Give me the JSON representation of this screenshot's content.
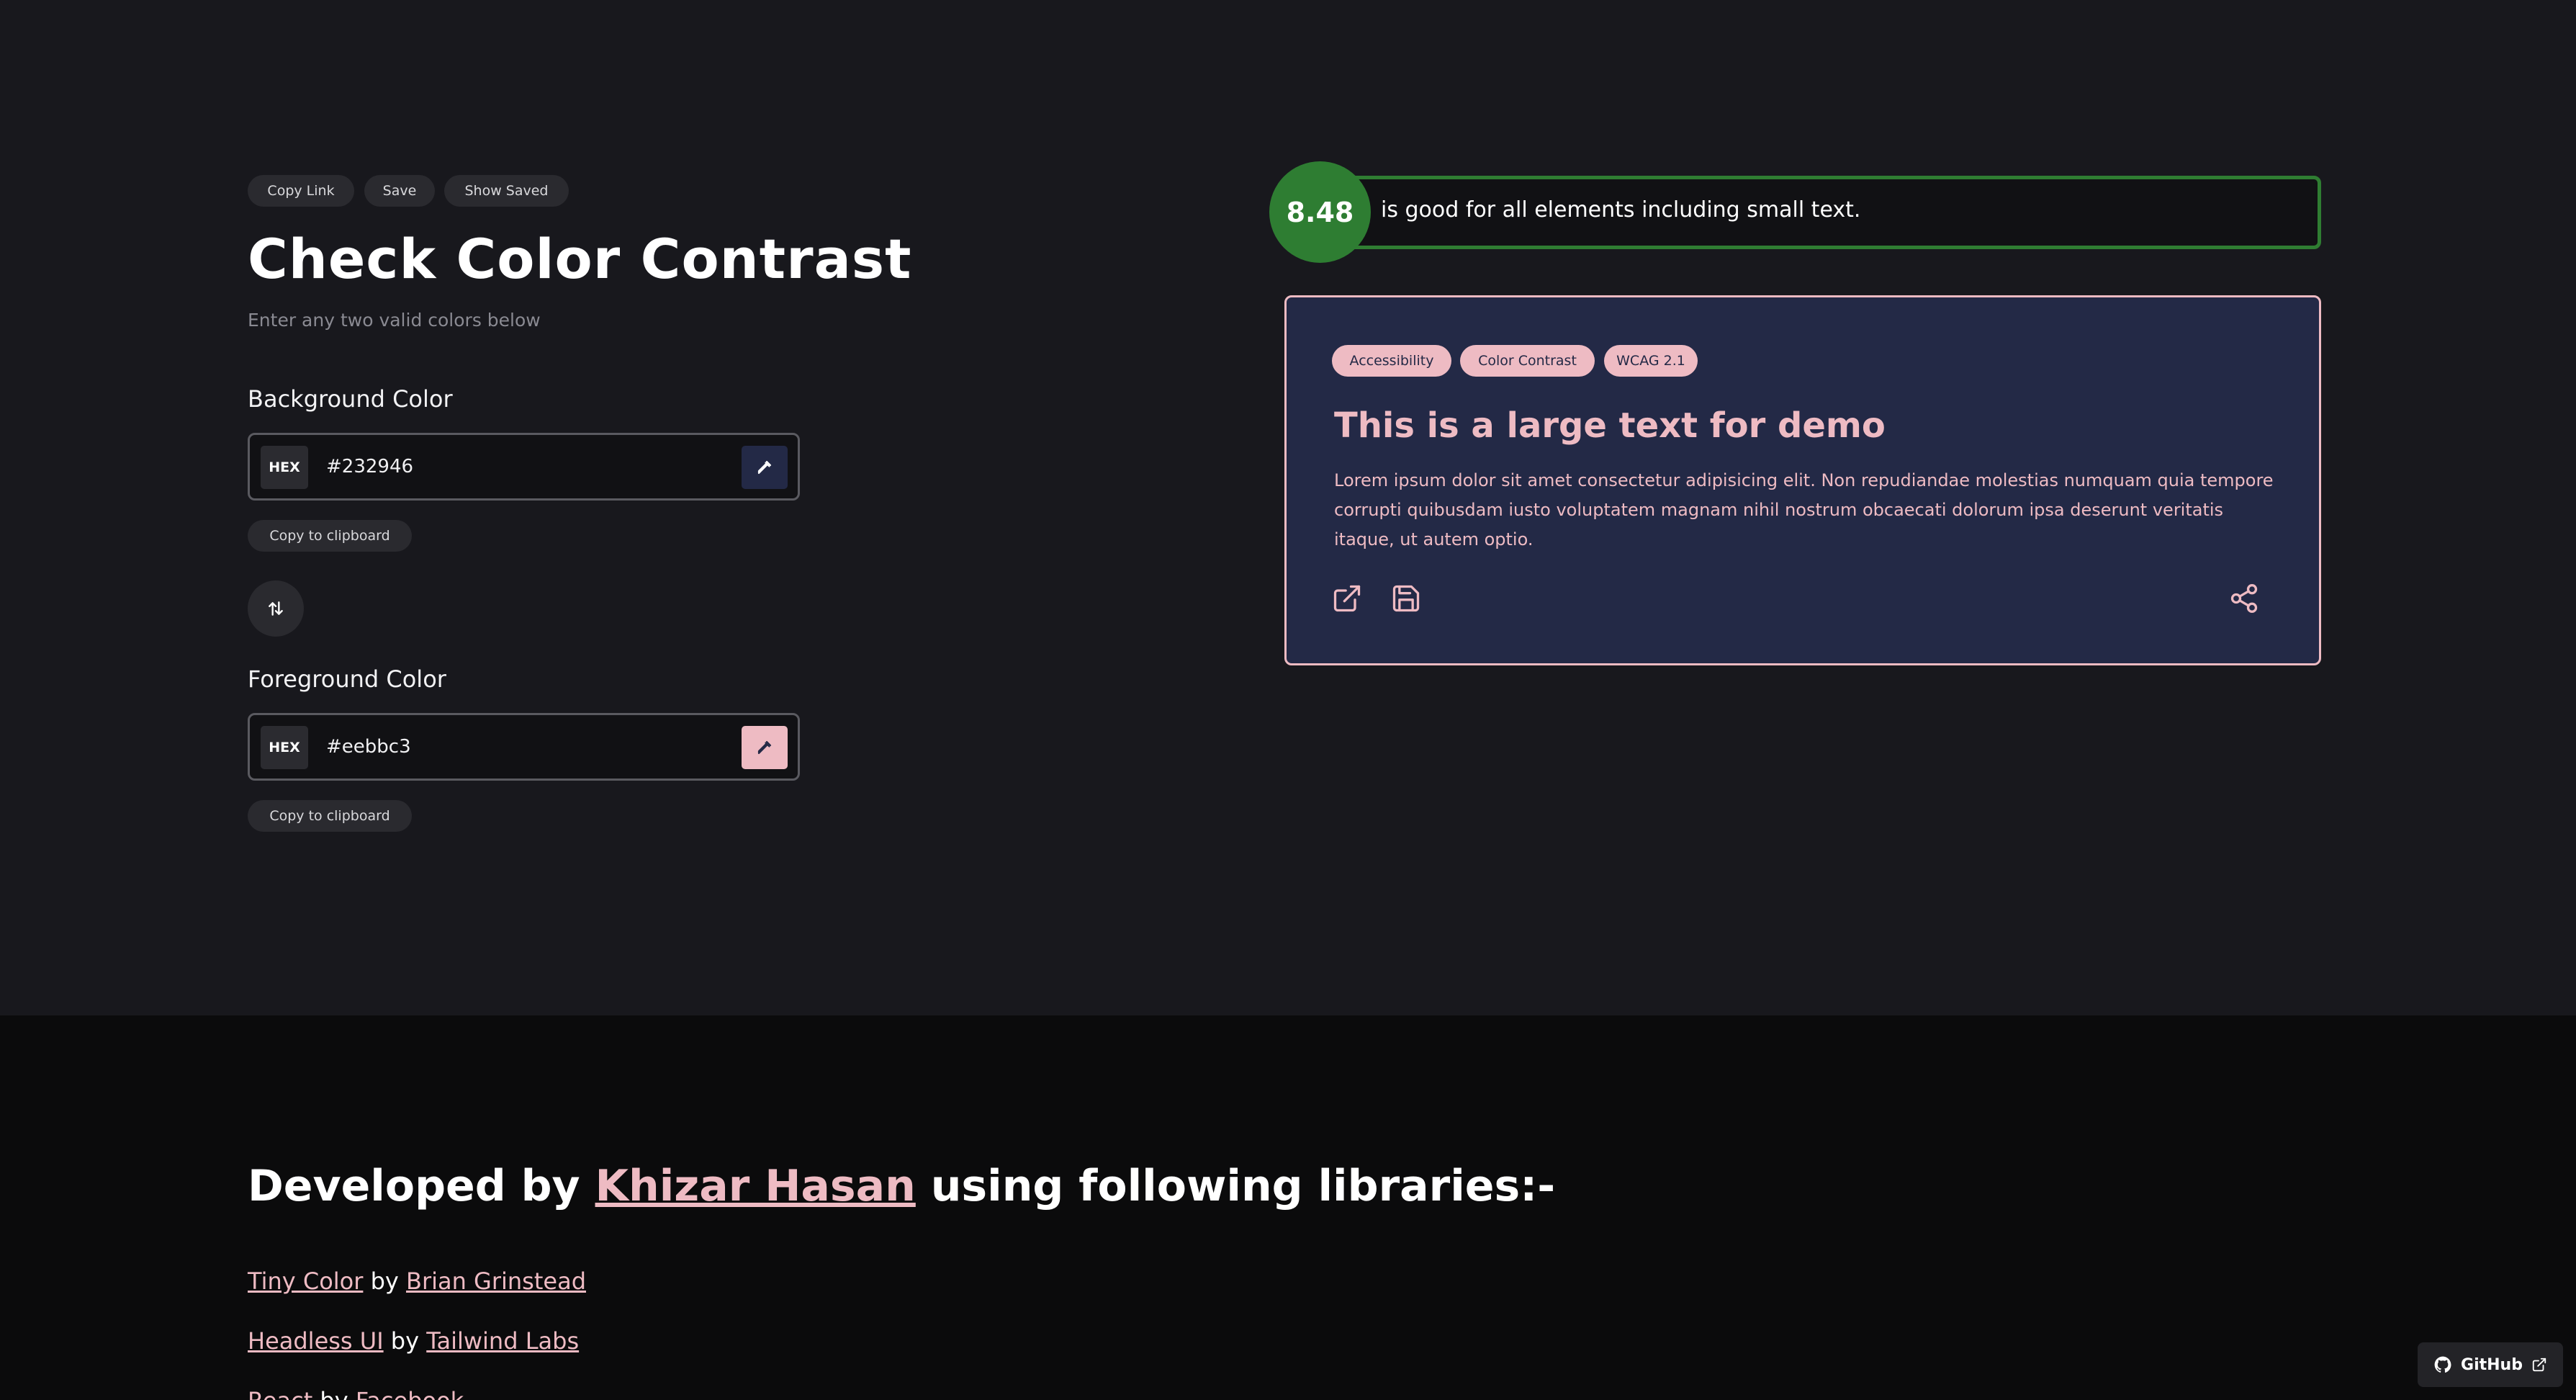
{
  "toolbar": {
    "copy_link": "Copy Link",
    "save": "Save",
    "show_saved": "Show Saved"
  },
  "header": {
    "title": "Check Color Contrast",
    "subtitle": "Enter any two valid colors below"
  },
  "background": {
    "label": "Background Color",
    "format": "HEX",
    "value": "#232946",
    "swatch_color": "#232946",
    "copy_label": "Copy to clipboard"
  },
  "foreground": {
    "label": "Foreground Color",
    "format": "HEX",
    "value": "#eebbc3",
    "swatch_color": "#eebbc3",
    "copy_label": "Copy to clipboard"
  },
  "score": {
    "ratio": "8.48",
    "message": "is good for all elements including small text.",
    "accent": "#2e7d32"
  },
  "preview": {
    "tags": [
      "Accessibility",
      "Color Contrast",
      "WCAG 2.1"
    ],
    "large_text": "This is a large text for demo",
    "paragraph": "Lorem ipsum dolor sit amet consectetur adipisicing elit. Non repudiandae molestias numquam quia tempore corrupti quibusdam iusto voluptatem magnam nihil nostrum obcaecati dolorum ipsa deserunt veritatis itaque, ut autem optio.",
    "icons": [
      "external-link-icon",
      "save-icon",
      "share-icon"
    ]
  },
  "footer": {
    "dev_prefix": "Developed by",
    "dev_name": "Khizar Hasan",
    "dev_suffix": "using following libraries:-",
    "libraries": [
      {
        "name": "Tiny Color",
        "by": "by",
        "author": "Brian Grinstead"
      },
      {
        "name": "Headless UI",
        "by": "by",
        "author": "Tailwind Labs"
      },
      {
        "name": "React",
        "by": "by",
        "author": "Facebook"
      }
    ],
    "github_label": "GitHub"
  }
}
